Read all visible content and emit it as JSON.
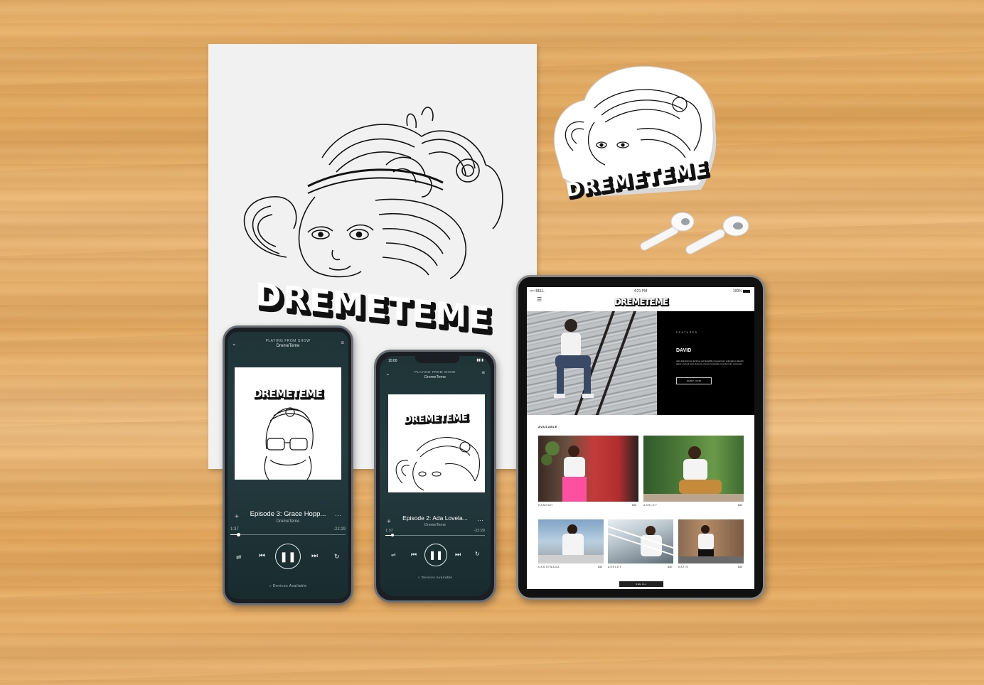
{
  "poster": {
    "brand": "DREMETEME"
  },
  "sticker": {
    "brand": "DREMETEME"
  },
  "phone1": {
    "header_top": "PLAYING FROM SHOW",
    "header_show": "DremeTeme",
    "album_brand": "DREMETEME",
    "episode_title": "Episode 3: Grace Hopp...",
    "artist": "DremeTeme",
    "time_elapsed": "1:37",
    "time_remaining": "-22:29",
    "progress": 0.07,
    "devices_label": "Devices Available"
  },
  "phone2": {
    "status_time": "10:00",
    "header_top": "PLAYING FROM SHOW",
    "header_show": "DremeTeme",
    "album_brand": "DREMETEME",
    "episode_title": "Episode 2: Ada Lovela...",
    "artist": "DremeTeme",
    "time_elapsed": "1:37",
    "time_remaining": "-22:29",
    "progress": 0.07,
    "devices_label": "Devices Available"
  },
  "tablet": {
    "status_carrier": "BELL",
    "status_time": "4:21 PM",
    "status_battery": "100%",
    "logo": "DREMETEME",
    "featured_label": "FEATURED",
    "featured_name": "DAVID",
    "featured_blurb": "odio dignissimos ducimus qui blanditiis praesentium voluptatum deleniti atque corrupti quos dolores et quas molestias excepturi sint occaecati",
    "shop_button": "SHOP NOW",
    "available_label": "AVAILABLE",
    "products": [
      {
        "name": "HANNAH",
        "price": "$30"
      },
      {
        "name": "ASHLEY",
        "price": "$30"
      },
      {
        "name": "CASTENADA",
        "price": "$30"
      },
      {
        "name": "ASHLEY",
        "price": "$30"
      },
      {
        "name": "KATIE",
        "price": "$30"
      }
    ],
    "see_all": "SEE ALL"
  },
  "colors": {
    "screen_bg": "#1f3437",
    "wood": "#e9b46f",
    "tablet_black": "#000000"
  }
}
